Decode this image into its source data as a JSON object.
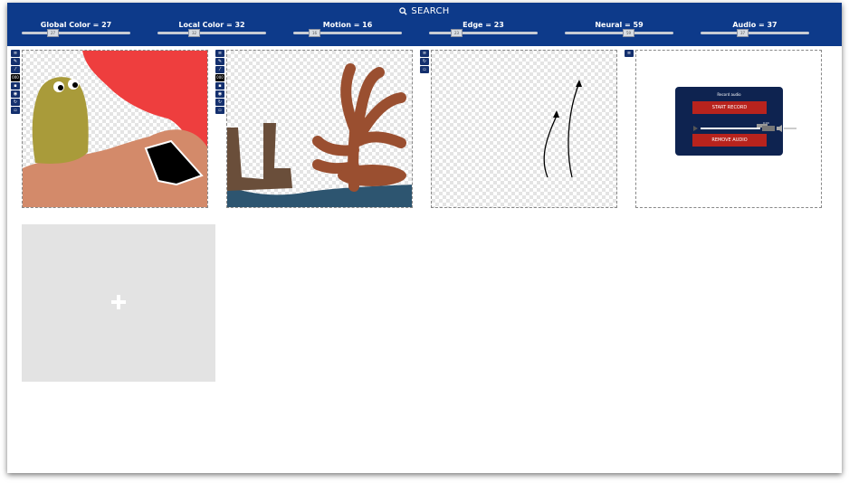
{
  "search": {
    "label": "SEARCH",
    "icon": "search-icon"
  },
  "sliders": [
    {
      "label": "Global Color = 27",
      "value": 27
    },
    {
      "label": "Local Color = 32",
      "value": 32
    },
    {
      "label": "Motion = 16",
      "value": 16
    },
    {
      "label": "Edge = 23",
      "value": 23
    },
    {
      "label": "Neural = 59",
      "value": 59
    },
    {
      "label": "Audio = 37",
      "value": 37
    }
  ],
  "toolbar": {
    "menu_icon": "menu-icon",
    "brush_icon": "brush-icon",
    "eyedropper_icon": "eyedropper-icon",
    "size_value": "000",
    "file_icon": "file-icon",
    "camera_icon": "camera-icon",
    "refresh_icon": "refresh-icon",
    "delete_icon": "trash-icon"
  },
  "record_audio": {
    "title": "Record audio",
    "start_label": "START RECORD",
    "remove_label": "REMOVE AUDIO",
    "time_label": "0:00"
  },
  "add_tile": {
    "icon": "plus-icon"
  },
  "colors": {
    "brand": "#0d3a8a",
    "panel_dark": "#0e2350",
    "button_red": "#b8231d",
    "tile_gray": "#e3e3e3"
  }
}
